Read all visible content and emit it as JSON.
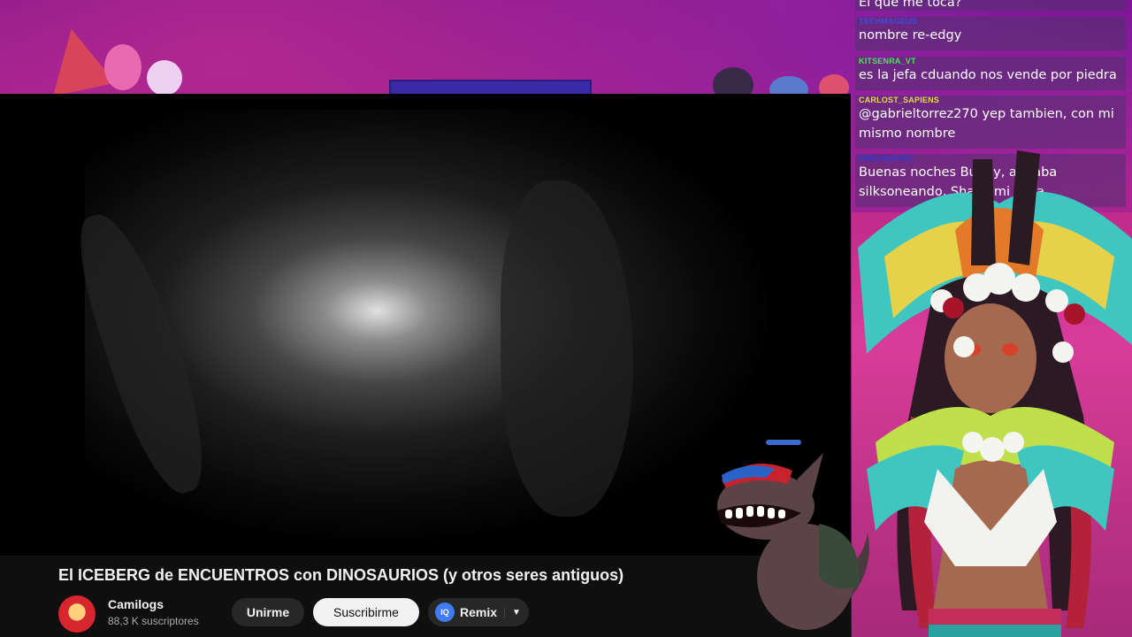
{
  "video": {
    "title": "El ICEBERG de ENCUENTROS con DINOSAURIOS (y otros seres antiguos)"
  },
  "channel": {
    "name": "Camilogs",
    "subscribers": "88,3 K suscriptores"
  },
  "actions": {
    "join_label": "Unirme",
    "subscribe_label": "Suscribirme",
    "remix_label": "Remix",
    "remix_icon_text": "IQ"
  },
  "chat": {
    "messages": [
      {
        "user": "",
        "text": "El que me toca?",
        "color": "#ffffff"
      },
      {
        "user": "TECHMAGEUS",
        "text": "nombre re-edgy",
        "color": "#3d4bd6"
      },
      {
        "user": "KITSENRA_VT",
        "text": "es la jefa cduando nos vende por piedra",
        "color": "#50e060"
      },
      {
        "user": "CARLOST_SAPIENS",
        "text": "@gabrieltorrez270 yep tambien, con mi mismo nombre",
        "color": "#e8d84a"
      },
      {
        "user": "D4ND4DANIEL",
        "text": "Buenas noches Bunny, andaba silksoneando, Shaka mi vieja",
        "color": "#2a3bd0"
      }
    ]
  },
  "colors": {
    "yt_bg": "#0f0f0f",
    "subscribe_bg": "#f1f1f1",
    "accent_blue": "#3e7bf6"
  }
}
